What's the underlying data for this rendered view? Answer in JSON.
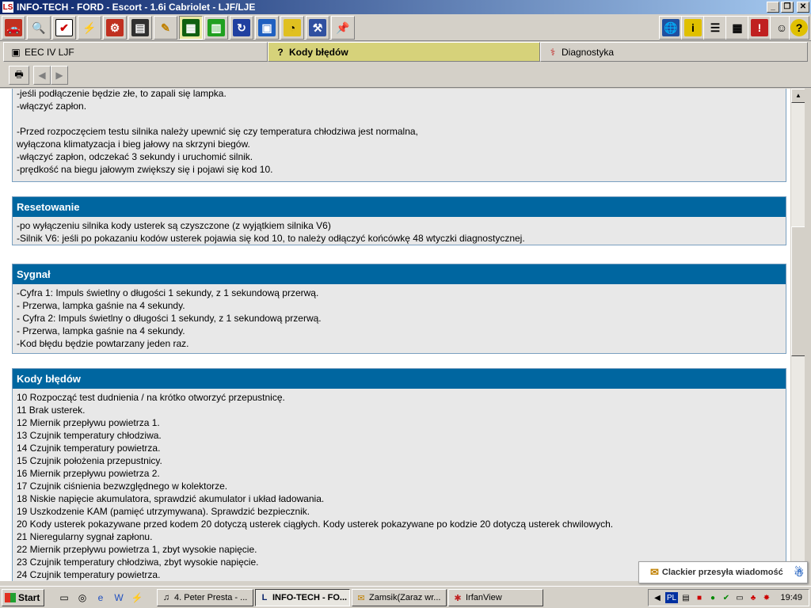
{
  "window": {
    "title": "INFO-TECH - FORD - Escort - 1.6i Cabriolet - LJF/LJE",
    "logo": "LS"
  },
  "toolbar": {
    "left_icons": [
      "car-icon",
      "search-icon",
      "checklist-icon",
      "plug-icon",
      "engine-icon",
      "ecu-icon",
      "pencil-icon",
      "circuit-icon",
      "connector-icon",
      "timing-icon",
      "board-icon",
      "gauge-icon",
      "tools-icon",
      "pin-icon"
    ],
    "right_icons": [
      "globe-icon",
      "info-icon",
      "list-icon",
      "calculator-icon",
      "warning-icon",
      "mechanic-icon",
      "help-icon"
    ]
  },
  "tabs": [
    {
      "label": "EEC IV LJF",
      "icon": "module-icon"
    },
    {
      "label": "Kody błędów",
      "icon": "error-codes-icon"
    },
    {
      "label": "Diagnostyka",
      "icon": "stethoscope-icon"
    }
  ],
  "subbar": {
    "print_icon": "print-icon",
    "back_icon": "back-arrow-icon",
    "forward_icon": "forward-arrow-icon"
  },
  "sections": {
    "intro": {
      "lines": [
        "-jeśli podłączenie będzie złe, to zapali się lampka.",
        "-włączyć zapłon.",
        "",
        "-Przed rozpoczęciem testu silnika należy upewnić się czy temperatura chłodziwa jest normalna,",
        "wyłączona klimatyzacja i bieg jałowy na skrzyni biegów.",
        "-włączyć zapłon, odczekać 3 sekundy i uruchomić silnik.",
        "-prędkość na biegu jałowym zwiększy się i pojawi się kod 10."
      ]
    },
    "reset": {
      "title": "Resetowanie",
      "lines": [
        "-po wyłączeniu silnika kody usterek są czyszczone (z wyjątkiem silnika V6)",
        "-Silnik V6: jeśli po pokazaniu kodów usterek pojawia się kod 10, to należy odłączyć końcówkę 48 wtyczki diagnostycznej."
      ]
    },
    "signal": {
      "title": "Sygnał",
      "lines": [
        "-Cyfra 1: Impuls świetlny o długości 1 sekundy, z 1 sekundową przerwą.",
        "- Przerwa, lampka gaśnie na 4 sekundy.",
        "- Cyfra 2: Impuls świetlny o długości 1 sekundy, z 1 sekundową przerwą.",
        "- Przerwa, lampka gaśnie na 4 sekundy.",
        "-Kod błędu będzie powtarzany jeden raz."
      ]
    },
    "codes": {
      "title": "Kody błędów",
      "lines": [
        "10 Rozpocząć test dudnienia / na krótko otworzyć przepustnicę.",
        "11 Brak usterek.",
        "12 Miernik przepływu powietrza 1.",
        "13 Czujnik temperatury chłodziwa.",
        "14 Czujnik temperatury powietrza.",
        "15 Czujnik położenia przepustnicy.",
        "16 Miernik przepływu powietrza 2.",
        "17 Czujnik ciśnienia bezwzględnego w kolektorze.",
        "18 Niskie napięcie akumulatora, sprawdzić akumulator i układ ładowania.",
        "19 Uszkodzenie KAM (pamięć utrzymywana). Sprawdzić bezpiecznik.",
        "20 Kody usterek pokazywane przed kodem 20 dotyczą usterek ciągłych. Kody usterek pokazywane po kodzie 20 dotyczą usterek chwilowych.",
        "21 Nieregularny sygnał zapłonu.",
        "22 Miernik przepływu powietrza 1, zbyt wysokie napięcie.",
        "23 Czujnik temperatury chłodziwa, zbyt wysokie napięcie.",
        "24 Czujnik temperatury powietrza."
      ]
    }
  },
  "notification": {
    "text": "Clackier przesyła wiadomość",
    "icon": "envelope-icon"
  },
  "taskbar": {
    "start_label": "Start",
    "tasks": [
      {
        "label": "4. Peter Presta - ...",
        "icon": "music-icon"
      },
      {
        "label": "INFO-TECH - FO...",
        "icon": "app-icon",
        "active": true
      },
      {
        "label": "Zamsik(Zaraz wr...",
        "icon": "mail-icon"
      },
      {
        "label": "IrfanView",
        "icon": "irfanview-icon"
      }
    ],
    "lang": "PL",
    "clock": "19:49"
  },
  "colors": {
    "section_header": "#0066a0",
    "active_tab": "#d6d27a",
    "titlebar": "#0a246a"
  }
}
